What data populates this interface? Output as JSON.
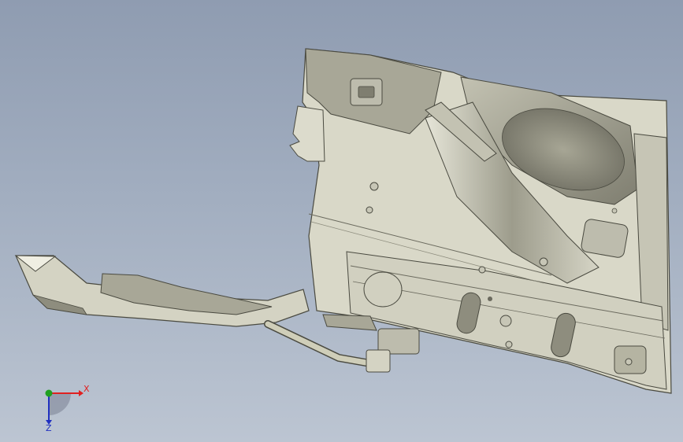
{
  "triad": {
    "x_label": "X",
    "z_label": "Z",
    "colors": {
      "x": "#e02020",
      "y": "#20a020",
      "z": "#2030c0"
    }
  },
  "model": {
    "fill": "#d9d8c8",
    "shade": "#b5b4a2",
    "dark": "#8e8d7e",
    "edge": "#4a4a40"
  }
}
